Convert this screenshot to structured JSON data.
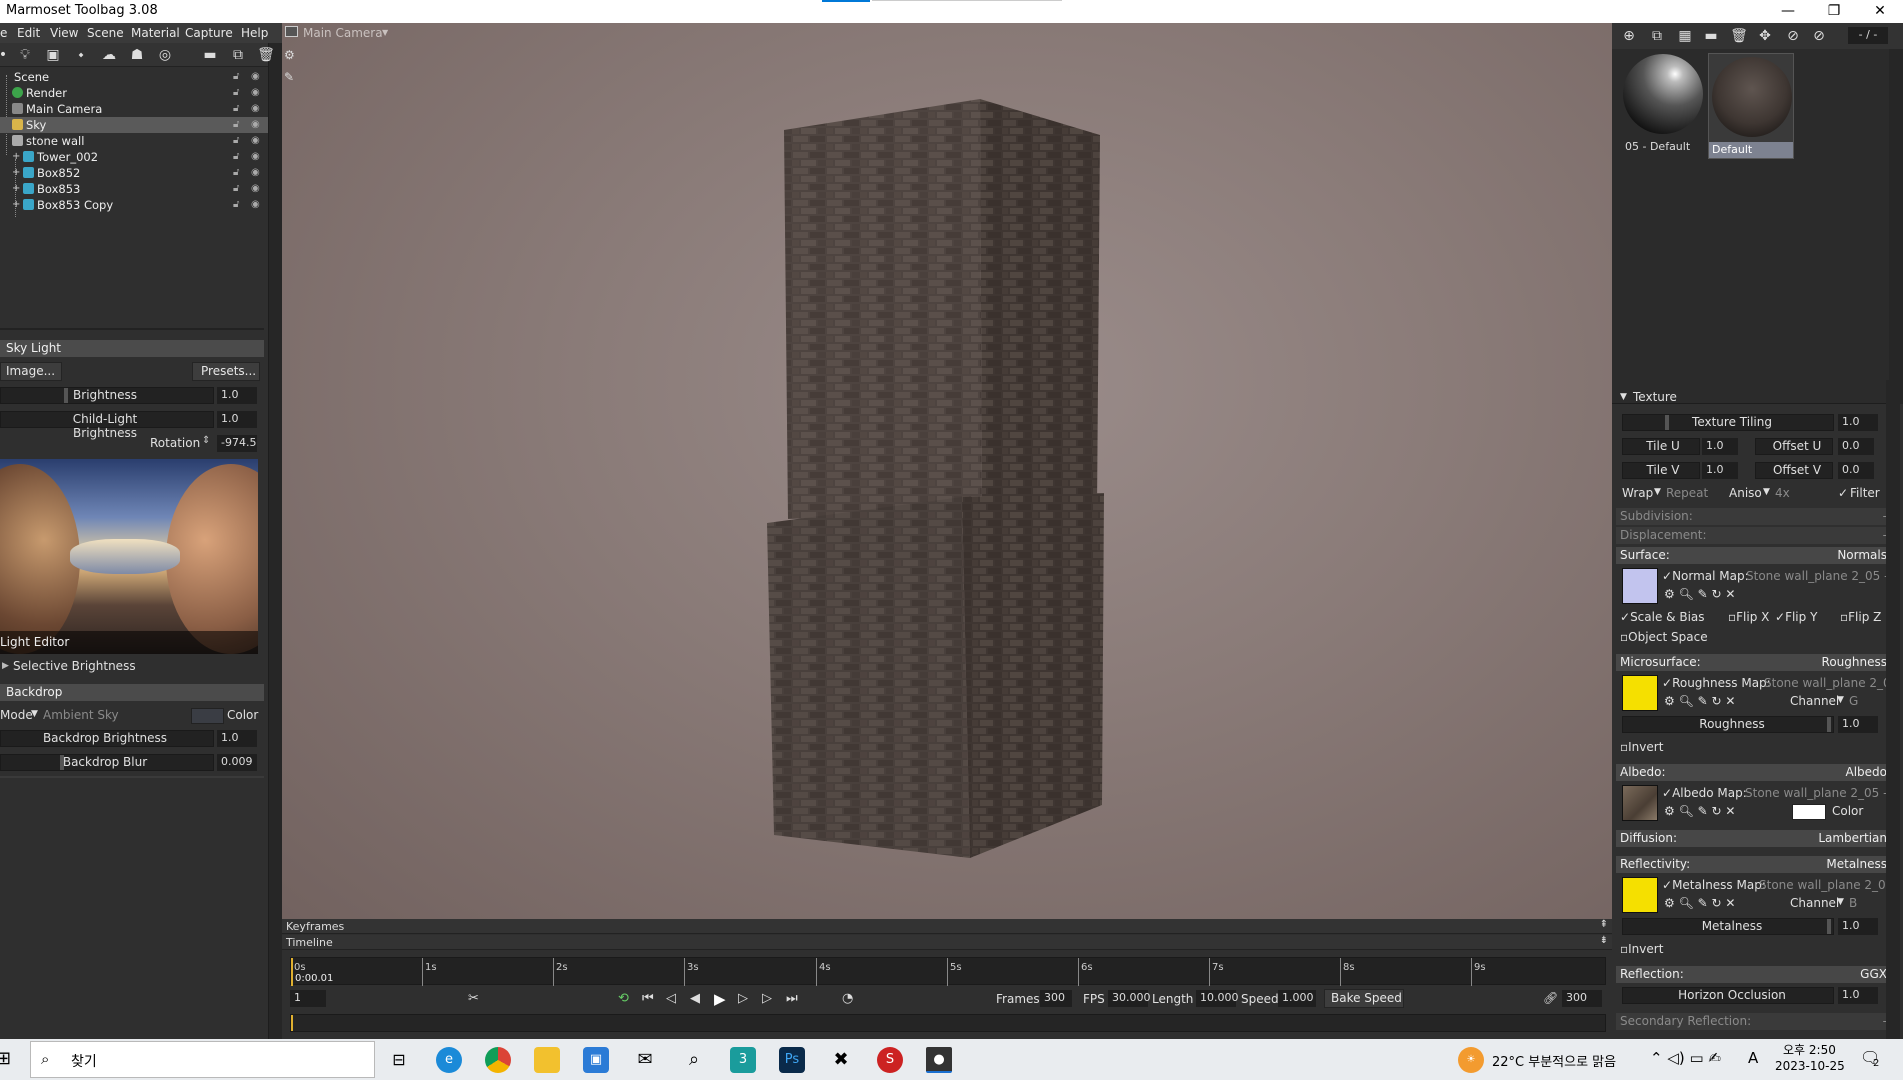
{
  "window": {
    "title": "Marmoset Toolbag 3.08",
    "minimize": "—",
    "restore": "❐",
    "close": "✕"
  },
  "menu": [
    "e",
    "Edit",
    "View",
    "Scene",
    "Material",
    "Capture",
    "Help"
  ],
  "scene_tree": [
    {
      "label": "Scene",
      "icon": "scene-icon"
    },
    {
      "label": "Render",
      "icon": "render-icon"
    },
    {
      "label": "Main Camera",
      "icon": "camera-icon"
    },
    {
      "label": "Sky",
      "icon": "sky-icon",
      "selected": true
    },
    {
      "label": "stone wall",
      "icon": "group-icon"
    },
    {
      "label": "Tower_002",
      "icon": "mesh-icon"
    },
    {
      "label": "Box852",
      "icon": "mesh-icon"
    },
    {
      "label": "Box853",
      "icon": "mesh-icon"
    },
    {
      "label": "Box853 Copy",
      "icon": "mesh-icon"
    }
  ],
  "sky_light": {
    "header": "Sky Light",
    "image_btn": "Image...",
    "presets_btn": "Presets...",
    "brightness_label": "Brightness",
    "brightness": "1.0",
    "child_label": "Child-Light Brightness",
    "child_brightness": "1.0",
    "rotation_label": "Rotation",
    "rotation": "-974.5",
    "light_editor": "Light Editor",
    "selective": "Selective Brightness"
  },
  "backdrop": {
    "header": "Backdrop",
    "mode_label": "Mode",
    "mode_value": "Ambient Sky",
    "color_label": "Color",
    "brightness_label": "Backdrop Brightness",
    "brightness": "1.0",
    "blur_label": "Backdrop Blur",
    "blur": "0.009"
  },
  "viewport": {
    "camera": "Main Camera"
  },
  "timeline": {
    "keyframes": "Keyframes",
    "timeline": "Timeline",
    "ticks": [
      "0s",
      "1s",
      "2s",
      "3s",
      "4s",
      "5s",
      "6s",
      "7s",
      "8s",
      "9s"
    ],
    "current_time": "0:00.01",
    "frame": "1",
    "frames_label": "Frames",
    "frames": "300",
    "fps_label": "FPS",
    "fps": "30.000",
    "length_label": "Length",
    "length": "10.000",
    "speed_label": "Speed",
    "speed": "1.000",
    "bake_speed": "Bake Speed",
    "end_frame": "300"
  },
  "materials": {
    "counter": "- / -",
    "items": [
      {
        "label": "05 - Default"
      },
      {
        "label": "Default",
        "selected": true
      }
    ]
  },
  "texture": {
    "header": "Texture",
    "tiling_label": "Texture Tiling",
    "tiling": "1.0",
    "tile_u_label": "Tile U",
    "tile_u": "1.0",
    "offset_u_label": "Offset U",
    "offset_u": "0.0",
    "tile_v_label": "Tile V",
    "tile_v": "1.0",
    "offset_v_label": "Offset V",
    "offset_v": "0.0",
    "wrap_label": "Wrap",
    "wrap_value": "Repeat",
    "aniso_label": "Aniso",
    "aniso_value": "4x",
    "filter_label": "Filter"
  },
  "subdivision": {
    "label": "Subdivision:",
    "value": "-"
  },
  "displacement": {
    "label": "Displacement:",
    "value": "-"
  },
  "surface": {
    "label": "Surface:",
    "value": "Normals",
    "map_label": "Normal Map:",
    "map_value": "Stone wall_plane 2_05 - De",
    "scale_bias": "Scale & Bias",
    "flip_x": "Flip X",
    "flip_y": "Flip Y",
    "flip_z": "Flip Z",
    "object_space": "Object Space",
    "swatch_color": "#c2c4ee"
  },
  "microsurface": {
    "label": "Microsurface:",
    "value": "Roughness",
    "map_label": "Roughness Map:",
    "map_value": "Stone wall_plane 2_05 -",
    "channel_label": "Channel",
    "channel": "G",
    "roughness_label": "Roughness",
    "roughness": "1.0",
    "invert": "Invert",
    "swatch_color": "#f5e000"
  },
  "albedo": {
    "label": "Albedo:",
    "value": "Albedo",
    "map_label": "Albedo Map:",
    "map_value": "Stone wall_plane 2_05 - Def",
    "color_label": "Color"
  },
  "diffusion": {
    "label": "Diffusion:",
    "value": "Lambertian"
  },
  "reflectivity": {
    "label": "Reflectivity:",
    "value": "Metalness",
    "map_label": "Metalness Map:",
    "map_value": "Stone wall_plane 2_05 -",
    "channel_label": "Channel",
    "channel": "B",
    "metalness_label": "Metalness",
    "metalness": "1.0",
    "invert": "Invert",
    "swatch_color": "#f5e000"
  },
  "reflection": {
    "label": "Reflection:",
    "value": "GGX",
    "horizon_label": "Horizon Occlusion",
    "horizon": "1.0"
  },
  "secondary_reflection": {
    "label": "Secondary Reflection:",
    "value": "-"
  },
  "taskbar": {
    "search_placeholder": "찾기",
    "weather": "22°C 부분적으로 맑음",
    "time": "오후 2:50",
    "date": "2023-10-25",
    "notifications": "2",
    "ime": "A"
  }
}
